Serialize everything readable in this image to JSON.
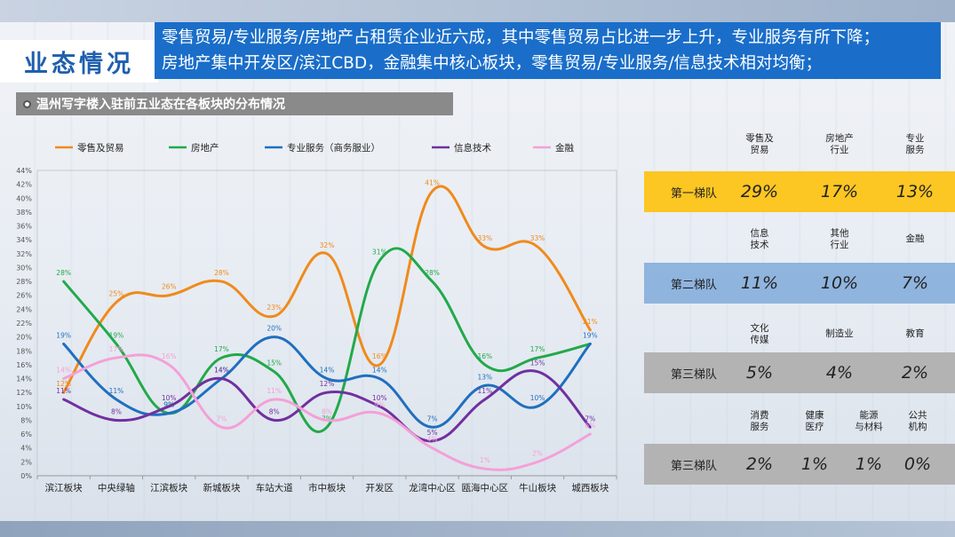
{
  "header": {
    "title": "业态情况",
    "desc_line1": "零售贸易/专业服务/房地产占租赁企业近六成，其中零售贸易占比进一步上升，专业服务有所下降；",
    "desc_line2": "房地产集中开发区/滨江CBD，金融集中核心板块，零售贸易/专业服务/信息技术相对均衡；"
  },
  "subtitle": "温州写字楼入驻前五业态在各板块的分布情况",
  "chart_data": {
    "type": "line",
    "categories": [
      "滨江板块",
      "中央绿轴",
      "江滨板块",
      "新城板块",
      "车站大道",
      "市中板块",
      "开发区",
      "龙湾中心区",
      "瓯海中心区",
      "牛山板块",
      "城西板块"
    ],
    "ylim": [
      0,
      44
    ],
    "yticks": [
      "0%",
      "2%",
      "4%",
      "6%",
      "8%",
      "10%",
      "12%",
      "14%",
      "16%",
      "18%",
      "20%",
      "22%",
      "24%",
      "26%",
      "28%",
      "30%",
      "32%",
      "34%",
      "36%",
      "38%",
      "40%",
      "42%",
      "44%"
    ],
    "series": [
      {
        "name": "零售及贸易",
        "color": "#f08a1c",
        "values": [
          12,
          25,
          26,
          28,
          23,
          32,
          16,
          41,
          33,
          33,
          21
        ],
        "labels": [
          "12%",
          "25%",
          "26%",
          "28%",
          "23%",
          "32%",
          "16%",
          "41%",
          "33%",
          "33%",
          "21%"
        ]
      },
      {
        "name": "房地产",
        "color": "#22a94a",
        "values": [
          28,
          19,
          9,
          17,
          15,
          7,
          31,
          28,
          16,
          17,
          19
        ],
        "labels": [
          "28%",
          "19%",
          "9%",
          "17%",
          "15%",
          "7%",
          "31%",
          "28%",
          "16%",
          "17%",
          ""
        ]
      },
      {
        "name": "专业服务（商务服业）",
        "color": "#1f6fbf",
        "values": [
          19,
          11,
          9,
          14,
          20,
          14,
          14,
          7,
          13,
          10,
          19
        ],
        "labels": [
          "19%",
          "11%",
          "9%",
          "14%",
          "20%",
          "14%",
          "14%",
          "7%",
          "13%",
          "10%",
          "19%"
        ]
      },
      {
        "name": "信息技术",
        "color": "#7030a0",
        "values": [
          11,
          8,
          10,
          14,
          8,
          12,
          10,
          5,
          11,
          15,
          7
        ],
        "labels": [
          "11%",
          "8%",
          "10%",
          "14%",
          "8%",
          "12%",
          "10%",
          "5%",
          "11%",
          "15%",
          "7%"
        ]
      },
      {
        "name": "金融",
        "color": "#f4a0d8",
        "values": [
          14,
          17,
          16,
          7,
          11,
          8,
          9,
          4,
          1,
          2,
          6
        ],
        "labels": [
          "14%",
          "17%",
          "16%",
          "7%",
          "11%",
          "8%",
          "9%",
          "4%",
          "1%",
          "2%",
          "6%"
        ]
      }
    ]
  },
  "tiers": [
    {
      "name": "第一梯队",
      "color": "#fcc623",
      "categories": [
        "零售及\n贸易",
        "房地产\n行业",
        "专业\n服务"
      ],
      "values": [
        "29%",
        "17%",
        "13%"
      ]
    },
    {
      "name": "第二梯队",
      "color": "#8fb4de",
      "categories": [
        "信息\n技术",
        "其他\n行业",
        "金融"
      ],
      "values": [
        "11%",
        "10%",
        "7%"
      ]
    },
    {
      "name": "第三梯队",
      "color": "#b3b3b3",
      "categories": [
        "文化\n传媒",
        "制造业",
        "教育"
      ],
      "values": [
        "5%",
        "4%",
        "2%"
      ]
    },
    {
      "name": "第三梯队",
      "color": "#b3b3b3",
      "categories": [
        "消费\n服务",
        "健康\n医疗",
        "能源\n与材料",
        "公共\n机构"
      ],
      "values": [
        "2%",
        "1%",
        "1%",
        "0%"
      ]
    }
  ]
}
